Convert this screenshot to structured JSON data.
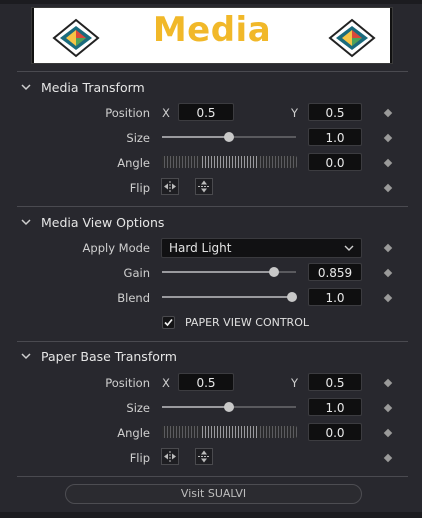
{
  "header": {
    "title": "Media"
  },
  "sections": {
    "media_transform": {
      "title": "Media Transform",
      "position_label": "Position",
      "x_label": "X",
      "x_value": "0.5",
      "y_label": "Y",
      "y_value": "0.5",
      "size_label": "Size",
      "size_value": "1.0",
      "size_fraction": 0.5,
      "angle_label": "Angle",
      "angle_value": "0.0",
      "flip_label": "Flip"
    },
    "media_view_options": {
      "title": "Media View Options",
      "apply_mode_label": "Apply Mode",
      "apply_mode_value": "Hard Light",
      "gain_label": "Gain",
      "gain_value": "0.859",
      "gain_fraction": 0.859,
      "blend_label": "Blend",
      "blend_value": "1.0",
      "blend_fraction": 1.0,
      "paper_view_label": "PAPER VIEW CONTROL",
      "paper_view_checked": true
    },
    "paper_base_transform": {
      "title": "Paper Base Transform",
      "position_label": "Position",
      "x_label": "X",
      "x_value": "0.5",
      "y_label": "Y",
      "y_value": "0.5",
      "size_label": "Size",
      "size_value": "1.0",
      "size_fraction": 0.5,
      "angle_label": "Angle",
      "angle_value": "0.0",
      "flip_label": "Flip"
    }
  },
  "footer": {
    "visit_label": "Visit SUALVI"
  },
  "icons": {
    "logo": "resolve-style-logo-icon",
    "section_toggle": "chevron-down-icon",
    "keyframe": "keyframe-diamond-icon",
    "flip_h": "flip-horizontal-icon",
    "flip_v": "flip-vertical-icon",
    "checkbox": "checkmark-icon"
  },
  "colors": {
    "title": "#f1b829",
    "background": "#28282e",
    "field": "#0f0f10"
  }
}
